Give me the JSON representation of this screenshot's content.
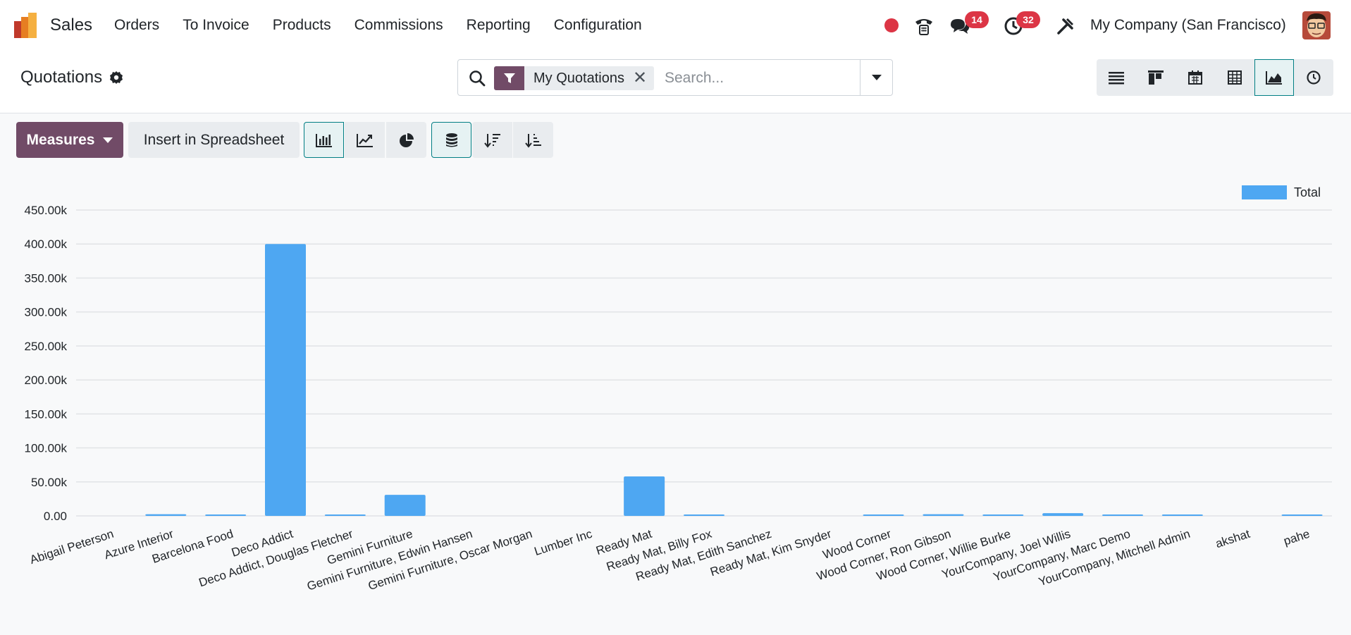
{
  "app": {
    "name": "Sales"
  },
  "menu": [
    "Orders",
    "To Invoice",
    "Products",
    "Commissions",
    "Reporting",
    "Configuration"
  ],
  "systray": {
    "messages_count": "14",
    "activities_count": "32",
    "company": "My Company (San Francisco)"
  },
  "breadcrumb": {
    "title": "Quotations"
  },
  "search": {
    "facet": "My Quotations",
    "placeholder": "Search..."
  },
  "toolbar": {
    "measures_label": "Measures",
    "insert_label": "Insert in Spreadsheet"
  },
  "colors": {
    "brand": "#714b67",
    "accent": "#017e84",
    "bar": "#4ea7f2",
    "badge": "#dc3545"
  },
  "chart_data": {
    "type": "bar",
    "categories": [
      "Abigail Peterson",
      "Azure Interior",
      "Barcelona Food",
      "Deco Addict",
      "Deco Addict, Douglas Fletcher",
      "Gemini Furniture",
      "Gemini Furniture, Edwin Hansen",
      "Gemini Furniture, Oscar Morgan",
      "Lumber Inc",
      "Ready Mat",
      "Ready Mat, Billy Fox",
      "Ready Mat, Edith Sanchez",
      "Ready Mat, Kim Snyder",
      "Wood Corner",
      "Wood Corner, Ron Gibson",
      "Wood Corner, Willie Burke",
      "YourCompany, Joel Willis",
      "YourCompany, Marc Demo",
      "YourCompany, Mitchell Admin",
      "akshat",
      "pahe"
    ],
    "series": [
      {
        "name": "Total",
        "values": [
          0,
          2500,
          500,
          400000,
          1500,
          31000,
          0,
          0,
          0,
          58000,
          500,
          0,
          0,
          500,
          2500,
          1500,
          4000,
          500,
          500,
          0,
          500
        ]
      }
    ],
    "ylim": [
      0,
      450000
    ],
    "yticks": [
      "0.00",
      "50.00k",
      "100.00k",
      "150.00k",
      "200.00k",
      "250.00k",
      "300.00k",
      "350.00k",
      "400.00k",
      "450.00k"
    ],
    "legend": "top-right",
    "grid": true
  }
}
